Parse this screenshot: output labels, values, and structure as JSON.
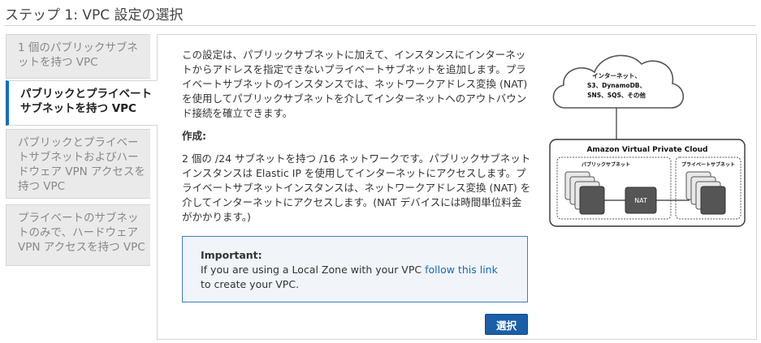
{
  "page": {
    "title": "ステップ 1: VPC 設定の選択"
  },
  "tabs": [
    {
      "label": "1 個のパブリックサブネットを持つ VPC"
    },
    {
      "label": "パブリックとプライベート サブネットを持つ VPC"
    },
    {
      "label": "パブリックとプライベートサブネットおよびハードウェア VPN アクセスを持つ VPC"
    },
    {
      "label": "プライベートのサブネットのみで、ハードウェア VPN アクセスを持つ VPC"
    }
  ],
  "content": {
    "description": "この設定は、パブリックサブネットに加えて、インスタンスにインターネットからアドレスを指定できないプライベートサブネットを追加します。プライベートサブネットのインスタンスでは、ネットワークアドレス変換 (NAT) を使用してパブリックサブネットを介してインターネットへのアウトバウンド接続を確立できます。",
    "create_heading": "作成:",
    "create_body": "2 個の /24 サブネットを持つ /16 ネットワークです。パブリックサブネットインスタンスは Elastic IP を使用してインターネットにアクセスします。プライベートサブネットインスタンスは、ネットワークアドレス変換 (NAT) を介してインターネットにアクセスします。(NAT デバイスには時間単位料金がかかります。)"
  },
  "notice": {
    "heading": "Important:",
    "text_before": "If you are using a Local Zone with your VPC ",
    "link": "follow this link",
    "text_after": " to create your VPC."
  },
  "diagram": {
    "cloud_line1": "インターネット、",
    "cloud_line2": "S3、DynamoDB、",
    "cloud_line3": "SNS、SQS、その他",
    "vpc_label": "Amazon Virtual Private Cloud",
    "public_subnet": "パブリックサブネット",
    "private_subnet": "プライベートサブネット",
    "nat": "NAT"
  },
  "buttons": {
    "select": "選択"
  }
}
